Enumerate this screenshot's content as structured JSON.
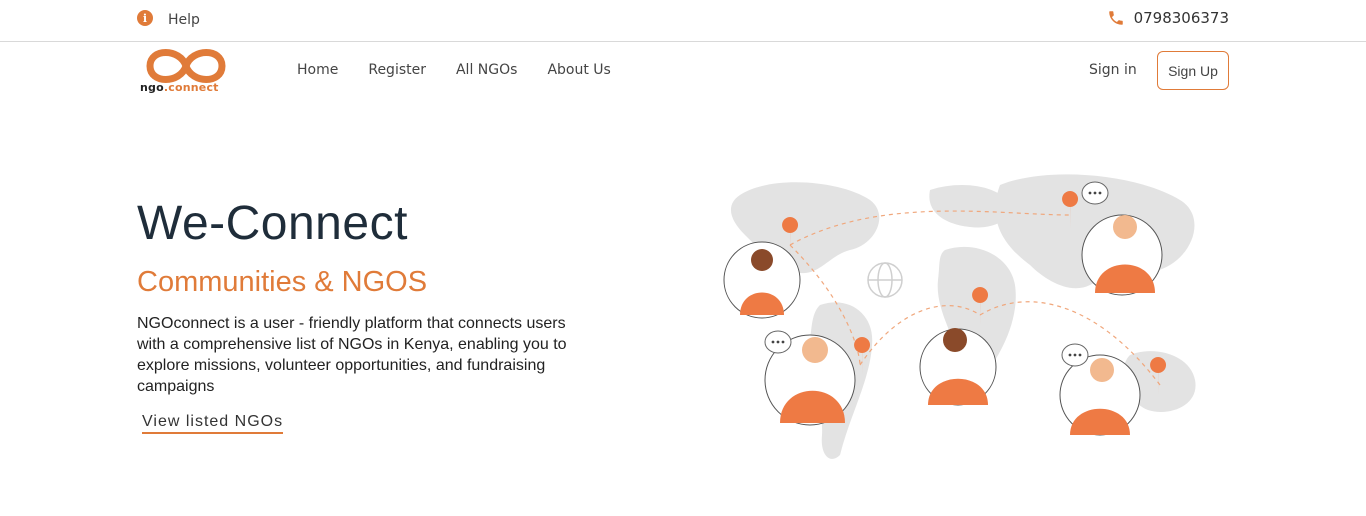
{
  "topbar": {
    "help_label": "Help",
    "help_icon": "info-icon",
    "phone_icon": "phone-icon",
    "phone_number": "0798306373"
  },
  "brand": {
    "logo_text_main": "ngo",
    "logo_text_accent": ".connect",
    "accent_color": "#e07b39"
  },
  "nav": {
    "links": [
      "Home",
      "Register",
      "All NGOs",
      "About Us"
    ],
    "signin_label": "Sign in",
    "signup_label": "Sign Up"
  },
  "hero": {
    "title": "We-Connect",
    "subtitle": "Communities & NGOS",
    "description": "NGOconnect is a user - friendly platform that connects users with a comprehensive list of NGOs in Kenya, enabling you to explore missions, volunteer opportunities, and fundraising campaigns",
    "cta_label": "View listed NGOs"
  }
}
